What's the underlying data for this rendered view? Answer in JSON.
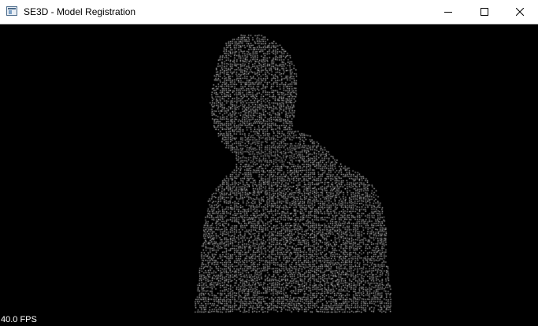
{
  "window": {
    "title": "SE3D - Model Registration",
    "app_icon": "application-window-icon",
    "controls": {
      "minimize_icon": "minimize-icon",
      "maximize_icon": "maximize-icon",
      "close_icon": "close-icon"
    }
  },
  "viewport": {
    "background": "#000000",
    "point_color": "#ffffff",
    "model": "point-cloud-bust",
    "fps_label": "40.0 FPS"
  }
}
